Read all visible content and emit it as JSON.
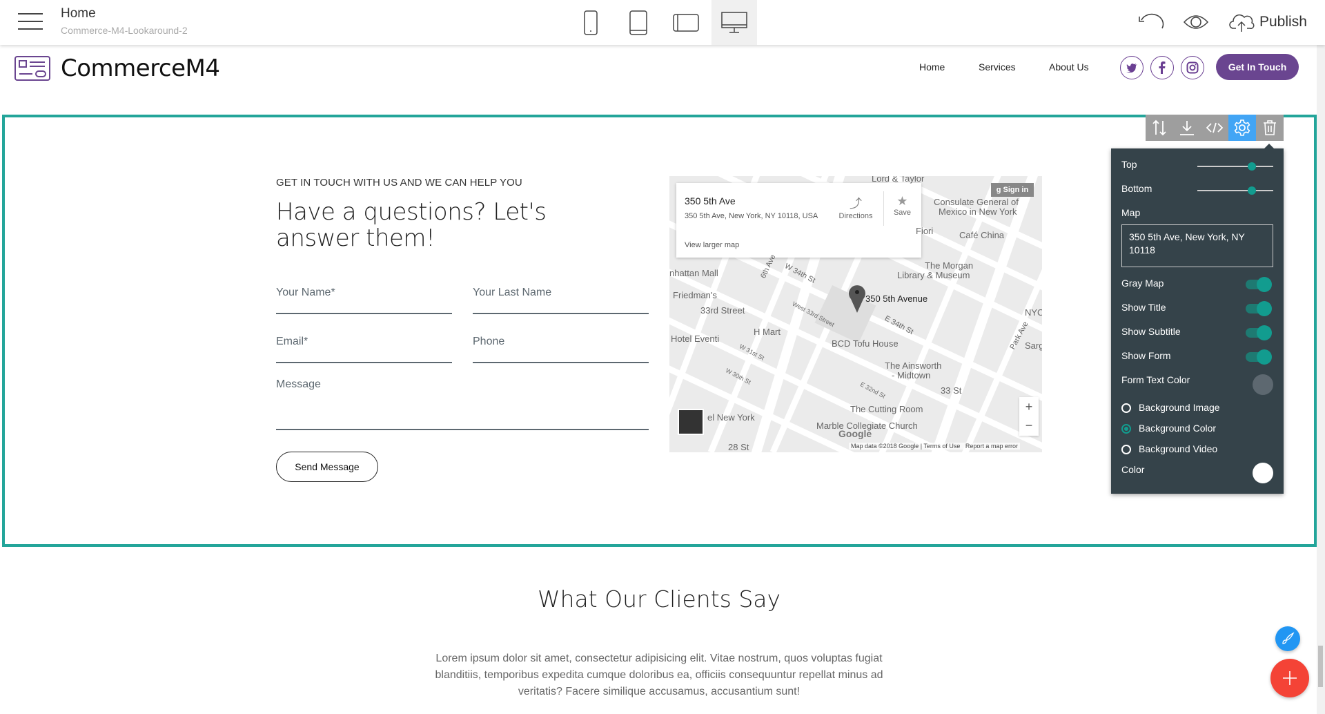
{
  "topbar": {
    "page_title": "Home",
    "project_name": "Commerce-M4-Lookaround-2",
    "devices": [
      "mobile-icon",
      "tablet-icon",
      "tablet-landscape-icon",
      "desktop-icon"
    ],
    "active_device": "desktop",
    "publish_label": "Publish"
  },
  "nav": {
    "brand": "CommerceM4",
    "links": [
      "Home",
      "Services",
      "About Us"
    ],
    "social": [
      "twitter-icon",
      "facebook-icon",
      "instagram-icon"
    ],
    "cta": "Get In Touch",
    "accent": "#6a4590"
  },
  "contact": {
    "subtitle": "GET IN TOUCH WITH US AND WE CAN HELP YOU",
    "title": "Have a questions? Let's answer them!",
    "fields": {
      "first_name": "Your Name*",
      "last_name": "Your Last Name",
      "email": "Email*",
      "phone": "Phone",
      "message": "Message"
    },
    "send_label": "Send Message"
  },
  "map": {
    "place_title": "350 5th Ave",
    "place_address": "350 5th Ave, New York, NY 10118, USA",
    "directions": "Directions",
    "save": "Save",
    "larger": "View larger map",
    "sign_in": "Sign in",
    "pin_label": "350 5th Avenue",
    "labels": [
      "Lord & Taylor",
      "Consulate General of",
      "Mexico in New York",
      "Fiori",
      "Café China",
      "The Morgan",
      "Library & Museum",
      "nhattan Mall",
      "Friedman's",
      "33rd Street",
      "W 34th St",
      "6th Ave",
      "West 33rd Street",
      "E 34th St",
      "NYC",
      "Park Ave",
      "Sarg",
      "H Mart",
      "BCD Tofu House",
      "Hotel Eventi",
      "W 31st St",
      "W 30th St",
      "The Ainsworth",
      "- Midtown",
      "E 32nd St",
      "33 St",
      "The Cutting Room",
      "el New York",
      "Marble Collegiate Church",
      "28 St"
    ],
    "footer": "Map data ©2018 Google",
    "terms": "Terms of Use",
    "report": "Report a map error",
    "google": "Google",
    "zoom_in": "+",
    "zoom_out": "−"
  },
  "section_toolbar": {
    "items": [
      "move-icon",
      "download-icon",
      "code-icon",
      "gear-icon",
      "trash-icon"
    ],
    "active": "gear-icon"
  },
  "settings": {
    "top_label": "Top",
    "top_value": 72,
    "bottom_label": "Bottom",
    "bottom_value": 72,
    "map_label": "Map",
    "map_value": "350 5th Ave, New York, NY 10118",
    "toggles": [
      {
        "label": "Gray Map",
        "on": true
      },
      {
        "label": "Show Title",
        "on": true
      },
      {
        "label": "Show Subtitle",
        "on": true
      },
      {
        "label": "Show Form",
        "on": true
      }
    ],
    "form_text_color_label": "Form Text Color",
    "form_text_color": "#5d6870",
    "background": [
      {
        "label": "Background Image",
        "selected": false
      },
      {
        "label": "Background Color",
        "selected": true
      },
      {
        "label": "Background Video",
        "selected": false
      }
    ],
    "color_label": "Color",
    "color": "#ffffff"
  },
  "clients": {
    "title": "What Our Clients Say",
    "text": "Lorem ipsum dolor sit amet, consectetur adipisicing elit. Vitae nostrum, quos voluptas fugiat blanditiis, temporibus expedita cumque doloribus ea, officiis consequuntur repellat minus ad veritatis? Facere similique accusamus, accusantium sunt!"
  },
  "colors": {
    "section_border": "#23a59a",
    "panel_bg": "#35434a",
    "toggle": "#129c8f",
    "fab_blue": "#2196f3",
    "fab_red": "#f44336"
  }
}
